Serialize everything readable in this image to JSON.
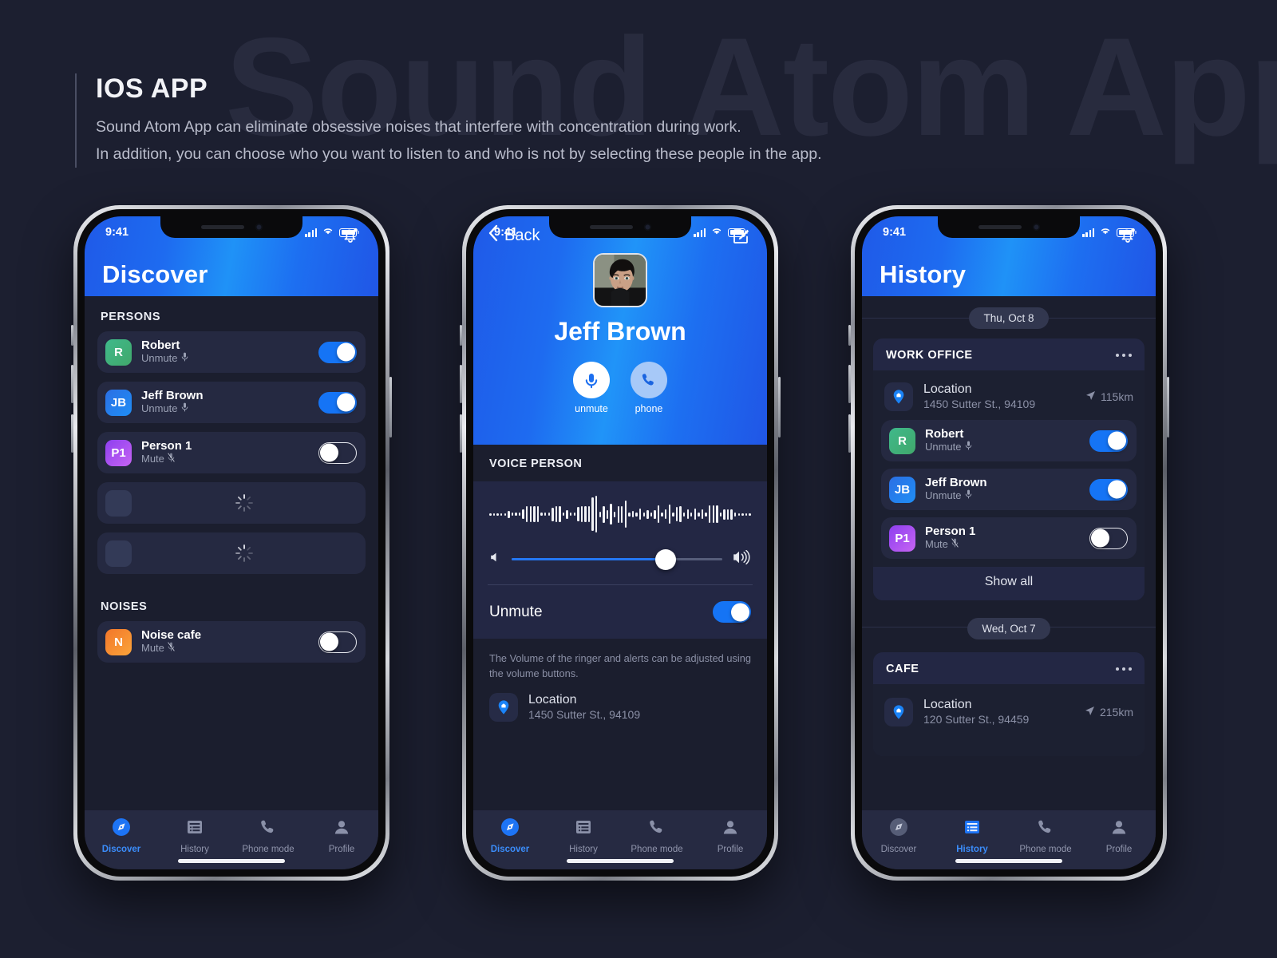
{
  "watermark": "Sound Atom App",
  "header": {
    "kicker": "IOS APP",
    "line1": "Sound Atom App can eliminate obsessive noises that interfere with concentration during work.",
    "line2": "In addition, you can choose who you want to listen to and who is not by selecting these people in the app."
  },
  "statusbar": {
    "time": "9:41"
  },
  "tabs": [
    {
      "label": "Discover",
      "icon": "compass-icon"
    },
    {
      "label": "History",
      "icon": "list-icon"
    },
    {
      "label": "Phone mode",
      "icon": "phone-icon"
    },
    {
      "label": "Profile",
      "icon": "person-icon"
    }
  ],
  "screen1": {
    "title": "Discover",
    "bell": "bell-icon",
    "sections": [
      {
        "label": "PERSONS"
      },
      {
        "label": "NOISES"
      }
    ],
    "persons": [
      {
        "initials": "R",
        "name": "Robert",
        "status": "Unmute",
        "mic": "mic-on-icon",
        "toggle": "on",
        "color_a": "#3fb98b",
        "color_b": "#41a86b"
      },
      {
        "initials": "JB",
        "name": "Jeff Brown",
        "status": "Unmute",
        "mic": "mic-on-icon",
        "toggle": "on",
        "color_a": "#2b6fe4",
        "color_b": "#1f8ef5"
      },
      {
        "initials": "P1",
        "name": "Person 1",
        "status": "Mute",
        "mic": "mic-off-icon",
        "toggle": "off",
        "color_a": "#8d3ff0",
        "color_b": "#c664f2"
      }
    ],
    "placeholders": 2,
    "noises": [
      {
        "initials": "N",
        "name": "Noise cafe",
        "status": "Mute",
        "mic": "mic-off-icon",
        "toggle": "off",
        "color_a": "#f2762a",
        "color_b": "#fba43a"
      }
    ],
    "active_tab": "Discover"
  },
  "screen2": {
    "back_label": "Back",
    "back_icon": "chevron-left-icon",
    "edit_icon": "edit-square-icon",
    "contact_name": "Jeff Brown",
    "actions": [
      {
        "label": "unmute",
        "icon": "mic-icon"
      },
      {
        "label": "phone",
        "icon": "phone-icon"
      }
    ],
    "group_label": "VOICE PERSON",
    "volume_percent": 73,
    "volume_low_icon": "speaker-low-icon",
    "volume_high_icon": "speaker-high-icon",
    "mute_label": "Unmute",
    "mute_toggle": "on",
    "note": "The Volume of the ringer and alerts can be adjusted using the volume buttons.",
    "location": {
      "icon": "map-pin-icon",
      "title": "Location",
      "address": "1450 Sutter St., 94109"
    },
    "active_tab": "Discover"
  },
  "screen3": {
    "title": "History",
    "bell": "bell-icon",
    "groups": [
      {
        "date": "Thu, Oct 8",
        "card_title": "WORK OFFICE",
        "menu_icon": "more-horizontal-icon",
        "location": {
          "icon": "map-pin-icon",
          "title": "Location",
          "address": "1450 Sutter St., 94109",
          "distance": "115km",
          "distance_icon": "navigation-icon"
        },
        "people": [
          {
            "initials": "R",
            "name": "Robert",
            "status": "Unmute",
            "mic": "mic-on-icon",
            "toggle": "on",
            "color_a": "#3fb98b",
            "color_b": "#41a86b"
          },
          {
            "initials": "JB",
            "name": "Jeff Brown",
            "status": "Unmute",
            "mic": "mic-on-icon",
            "toggle": "on",
            "color_a": "#2b6fe4",
            "color_b": "#1f8ef5"
          },
          {
            "initials": "P1",
            "name": "Person 1",
            "status": "Mute",
            "mic": "mic-off-icon",
            "toggle": "off",
            "color_a": "#8d3ff0",
            "color_b": "#c664f2"
          }
        ],
        "show_all": "Show all"
      },
      {
        "date": "Wed, Oct 7",
        "card_title": "CAFE",
        "menu_icon": "more-horizontal-icon",
        "location": {
          "icon": "map-pin-icon",
          "title": "Location",
          "address": "120 Sutter St., 94459",
          "distance": "215km",
          "distance_icon": "navigation-icon"
        }
      }
    ],
    "active_tab": "History"
  },
  "colors": {
    "page_bg": "#1c1f30",
    "accent_blue": "#1574f5",
    "card_bg": "#252941",
    "screen_bg": "#1b1e2e"
  }
}
